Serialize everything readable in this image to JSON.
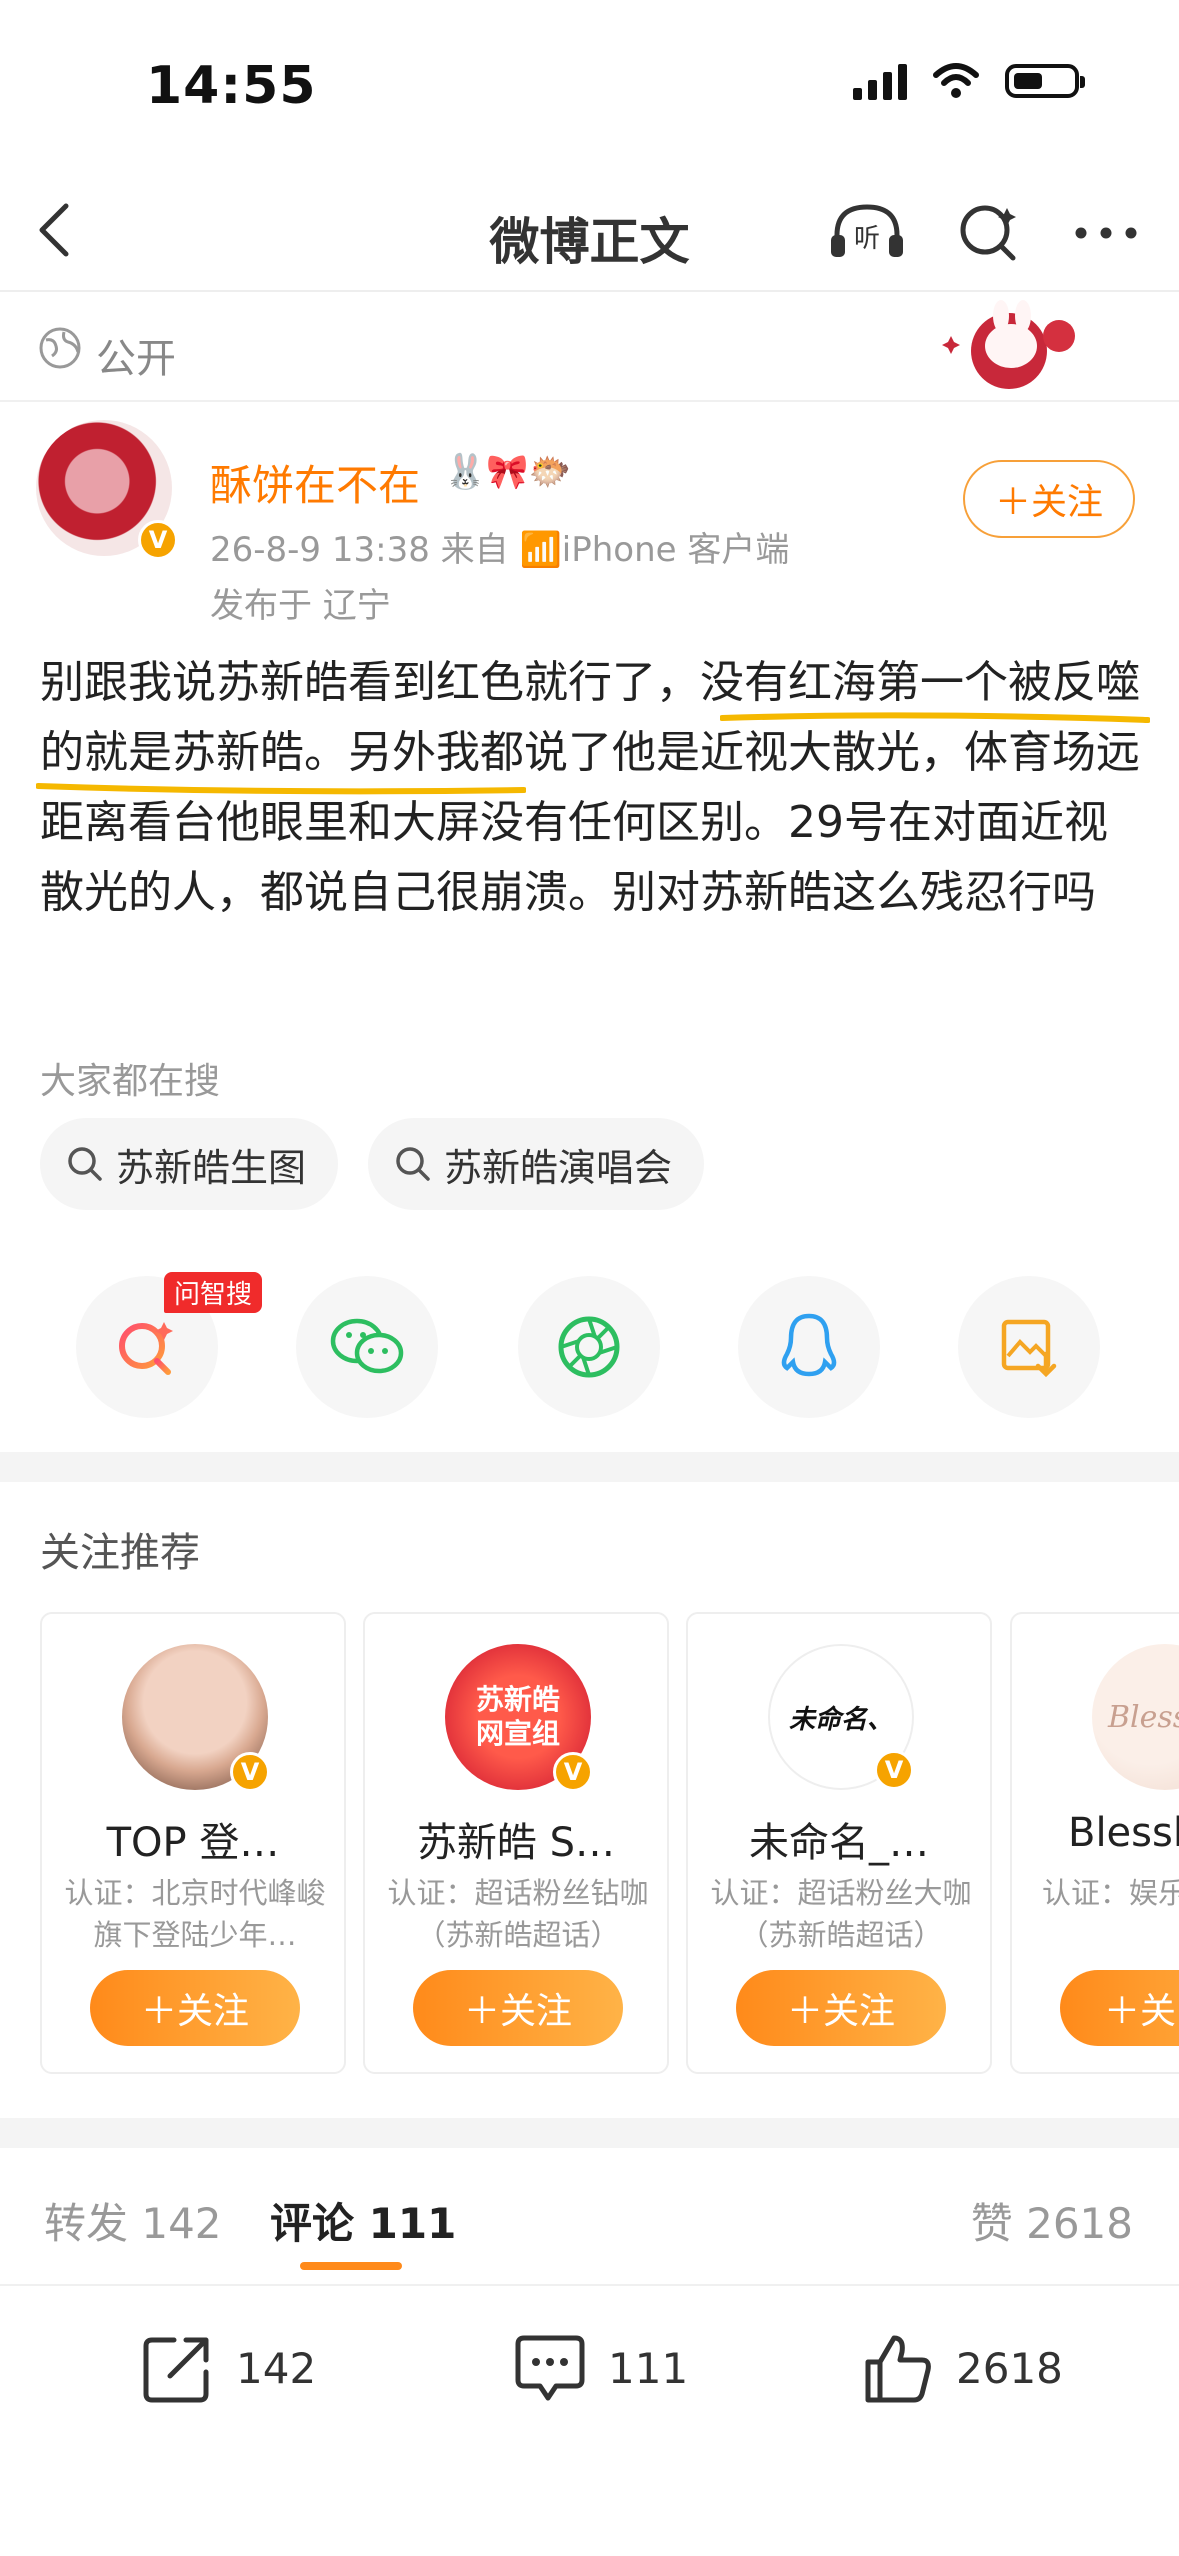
{
  "status_bar": {
    "time": "14:55"
  },
  "nav": {
    "title": "微博正文"
  },
  "visibility": {
    "label": "公开"
  },
  "post": {
    "username": "酥饼在不在",
    "user_emoji": "🐰🎀🐡",
    "meta": "26-8-9 13:38  来自 📶iPhone 客户端",
    "location": "发布于 辽宁",
    "follow_label": "＋关注",
    "body": "别跟我说苏新皓看到红色就行了，没有红海第一个被反噬的就是苏新皓。另外我都说了他是近视大散光，体育场远距离看台他眼里和大屏没有任何区别。29号在对面近视散光的人，都说自己很崩溃。别对苏新皓这么残忍行吗"
  },
  "hot_search": {
    "label": "大家都在搜",
    "chips": [
      "苏新皓生图",
      "苏新皓演唱会"
    ]
  },
  "share": {
    "ai_badge": "问智搜"
  },
  "recommend": {
    "title": "关注推荐",
    "cards": [
      {
        "name": "TOP 登…",
        "desc": "认证：北京时代峰峻旗下登陆少年…",
        "follow": "＋关注",
        "avatar_text": ""
      },
      {
        "name": "苏新皓 S…",
        "desc": "认证：超话粉丝钻咖（苏新皓超话）",
        "follow": "＋关注",
        "avatar_text": "苏新皓网宣组"
      },
      {
        "name": "未命名_…",
        "desc": "认证：超话粉丝大咖（苏新皓超话）",
        "follow": "＋关注",
        "avatar_text": "未命名、"
      },
      {
        "name": "Blessl",
        "desc": "认证：娱乐话创作官",
        "follow": "＋关",
        "avatar_text": "Bless"
      }
    ]
  },
  "tabs": {
    "repost": "转发 142",
    "comment": "评论 111",
    "like": "赞 2618"
  },
  "actions": {
    "repost": "142",
    "comment": "111",
    "like": "2618"
  }
}
